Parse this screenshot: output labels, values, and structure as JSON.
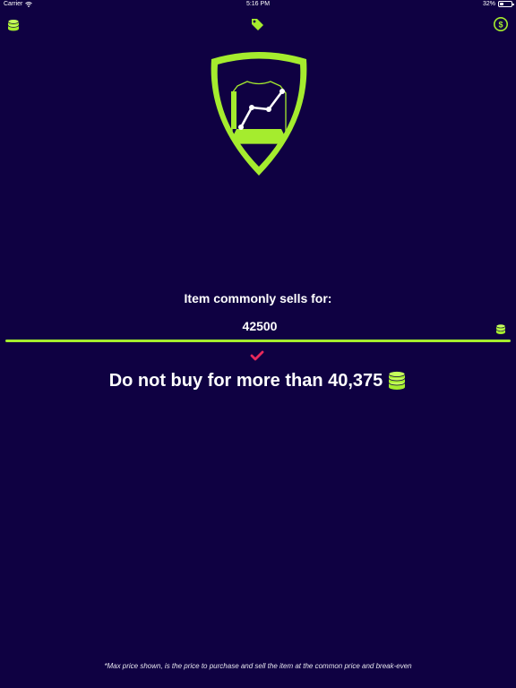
{
  "status_bar": {
    "carrier": "Carrier",
    "time": "5:16 PM",
    "battery": "32%",
    "battery_level": 0.32
  },
  "nav": {
    "left_icon": "coin-stack-icon",
    "center_icon": "price-tag-icon",
    "right_icon": "coin-dollar-icon"
  },
  "colors": {
    "background": "#0f0142",
    "accent": "#a5ec2e",
    "check": "#e8295b"
  },
  "main": {
    "label": "Item commonly sells for:",
    "price_value": "42500",
    "result_text": "Do not buy for more than 40,375",
    "footnote": "*Max price shown, is the price to purchase and sell the item at the common price and break-even"
  }
}
